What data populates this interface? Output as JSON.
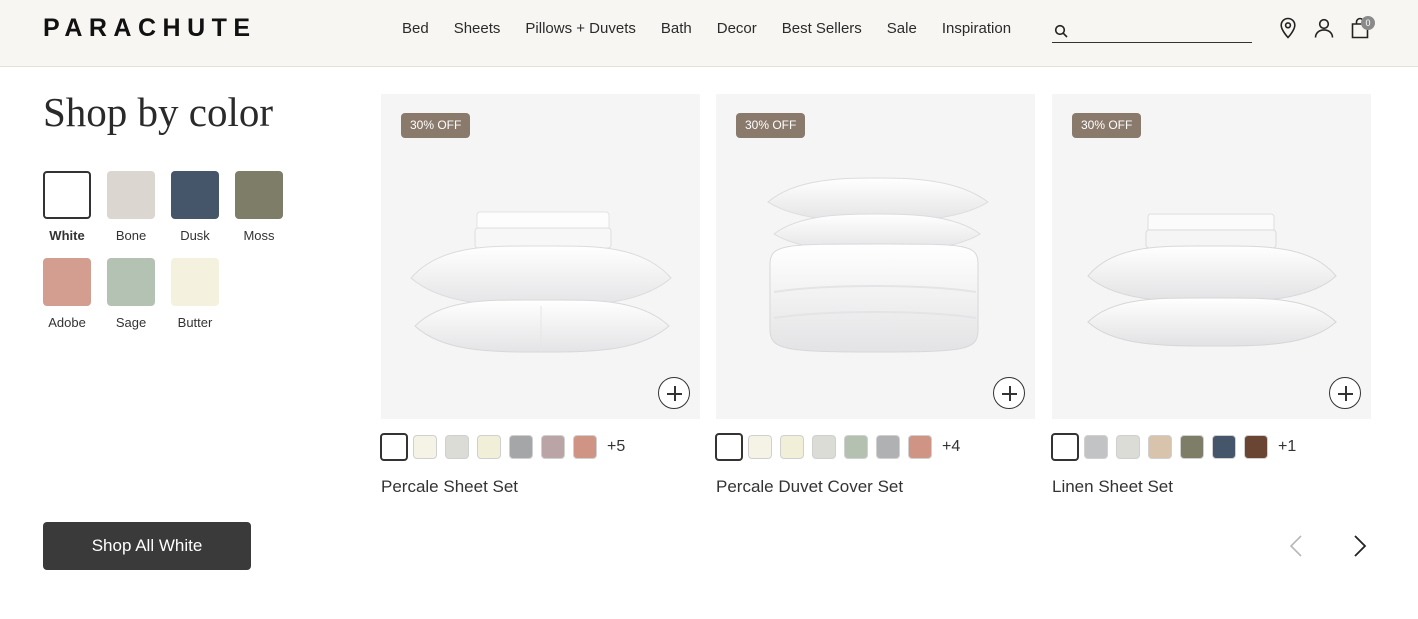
{
  "header": {
    "logo": "PARACHUTE",
    "nav": [
      "Bed",
      "Sheets",
      "Pillows + Duvets",
      "Bath",
      "Decor",
      "Best Sellers",
      "Sale",
      "Inspiration"
    ],
    "search": {
      "value": "",
      "placeholder": ""
    },
    "cart_count": "0",
    "icons": [
      "location-icon",
      "account-icon",
      "cart-icon",
      "search-icon"
    ]
  },
  "shop_by_color": {
    "title": "Shop by color",
    "swatches": [
      {
        "label": "White",
        "color": "#ffffff",
        "selected": true
      },
      {
        "label": "Bone",
        "color": "#dcd6d0"
      },
      {
        "label": "Dusk",
        "color": "#45556a"
      },
      {
        "label": "Moss",
        "color": "#7e7d67"
      },
      {
        "label": "Adobe",
        "color": "#d39d8f"
      },
      {
        "label": "Sage",
        "color": "#b4c2b3"
      },
      {
        "label": "Butter",
        "color": "#f4f1de"
      }
    ],
    "cta": "Shop All White"
  },
  "products": [
    {
      "name": "Percale Sheet Set",
      "badge": "30% OFF",
      "swatches": [
        "#ffffff",
        "#f5f3e6",
        "#dcdcd6",
        "#f2efd9",
        "#a4a6a8",
        "#bba4a6",
        "#d09484"
      ],
      "more": "+5"
    },
    {
      "name": "Percale Duvet Cover Set",
      "badge": "30% OFF",
      "swatches": [
        "#ffffff",
        "#f5f3e6",
        "#f2efd9",
        "#dcdcd6",
        "#b4c0b0",
        "#b0b1b3",
        "#d09484"
      ],
      "more": "+4"
    },
    {
      "name": "Linen Sheet Set",
      "badge": "30% OFF",
      "swatches": [
        "#ffffff",
        "#c2c3c4",
        "#dcdcd6",
        "#d8c3ad",
        "#7e7d67",
        "#45556a",
        "#6b4533"
      ],
      "more": "+1"
    }
  ]
}
